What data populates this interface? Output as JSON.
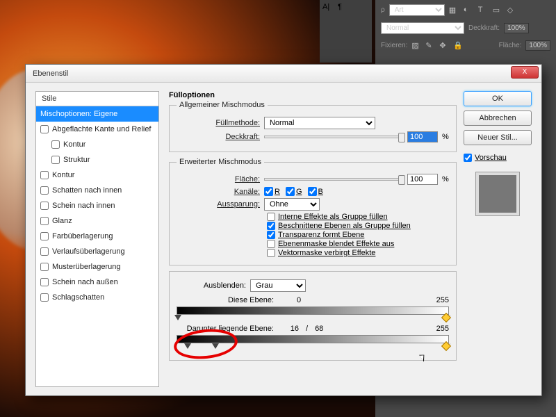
{
  "bgPanel": {
    "modeLabel": "Art",
    "blend": "Normal",
    "opacityLabel": "Deckkraft:",
    "opacity": "100%",
    "lockLabel": "Fixieren:",
    "fillLabel": "Fläche:",
    "fill": "100%"
  },
  "dialog": {
    "title": "Ebenenstil",
    "close": "X"
  },
  "stylelist": {
    "header": "Stile",
    "selected": "Mischoptionen: Eigene",
    "items": [
      {
        "label": "Abgeflachte Kante und Relief",
        "indent": false
      },
      {
        "label": "Kontur",
        "indent": true
      },
      {
        "label": "Struktur",
        "indent": true
      },
      {
        "label": "Kontur",
        "indent": false
      },
      {
        "label": "Schatten nach innen",
        "indent": false
      },
      {
        "label": "Schein nach innen",
        "indent": false
      },
      {
        "label": "Glanz",
        "indent": false
      },
      {
        "label": "Farbüberlagerung",
        "indent": false
      },
      {
        "label": "Verlaufsüberlagerung",
        "indent": false
      },
      {
        "label": "Musterüberlagerung",
        "indent": false
      },
      {
        "label": "Schein nach außen",
        "indent": false
      },
      {
        "label": "Schlagschatten",
        "indent": false
      }
    ]
  },
  "fill": {
    "groupTitle": "Fülloptionen",
    "general": {
      "legend": "Allgemeiner Mischmodus",
      "modeLabel": "Füllmethode:",
      "mode": "Normal",
      "opacityLabel": "Deckkraft:",
      "opacity": "100",
      "pct": "%"
    },
    "advanced": {
      "legend": "Erweiterter Mischmodus",
      "fillLabel": "Fläche:",
      "fill": "100",
      "pct": "%",
      "channelsLabel": "Kanäle:",
      "chanR": "R",
      "chanG": "G",
      "chanB": "B",
      "knockoutLabel": "Aussparung:",
      "knockout": "Ohne",
      "c1": "Interne Effekte als Gruppe füllen",
      "c2": "Beschnittene Ebenen als Gruppe füllen",
      "c3": "Transparenz formt Ebene",
      "c4": "Ebenenmaske blendet Effekte aus",
      "c5": "Vektormaske verbirgt Effekte"
    },
    "blendif": {
      "label": "Ausblenden:",
      "mode": "Grau",
      "thisLabel": "Diese Ebene:",
      "thisLow": "0",
      "thisHigh": "255",
      "underLabel": "Darunter liegende Ebene:",
      "underLow": "16",
      "underSep": "/",
      "underMid": "68",
      "underHigh": "255"
    }
  },
  "right": {
    "ok": "OK",
    "cancel": "Abbrechen",
    "newStyle": "Neuer Stil...",
    "preview": "Vorschau"
  }
}
